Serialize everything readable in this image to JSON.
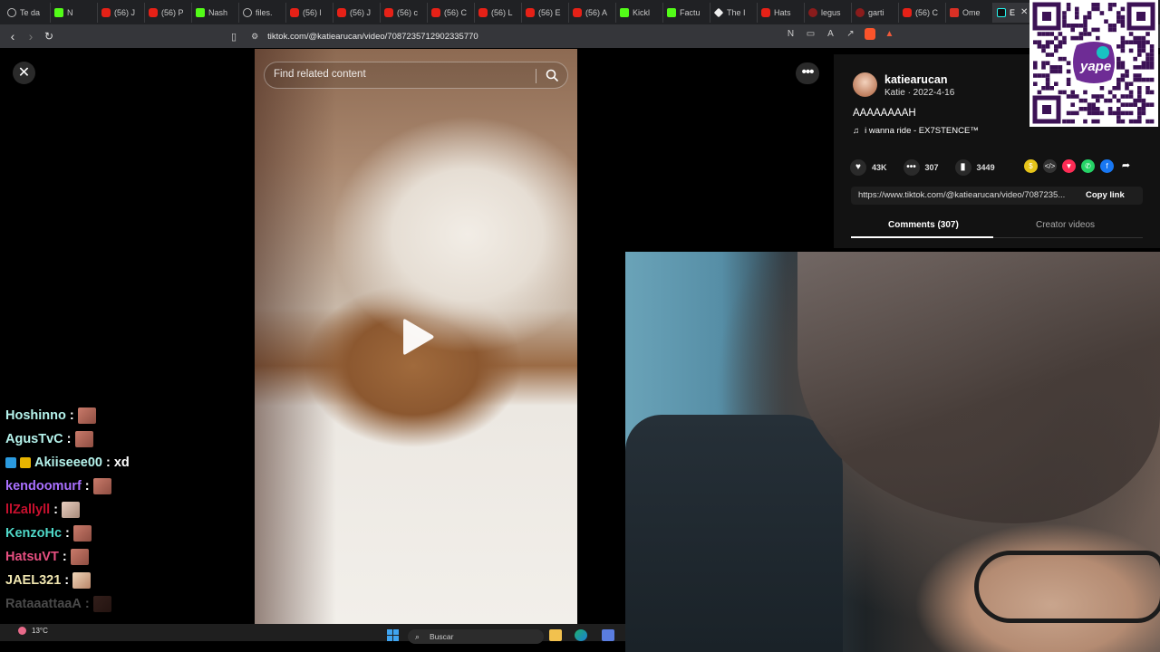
{
  "browser": {
    "tabs": [
      {
        "label": "Te da",
        "icon": "globe-icon"
      },
      {
        "label": "N",
        "icon": "kick-icon"
      },
      {
        "label": "(56) J",
        "icon": "youtube-icon"
      },
      {
        "label": "(56) P",
        "icon": "youtube-icon"
      },
      {
        "label": "Nash",
        "icon": "kick-icon"
      },
      {
        "label": "files.",
        "icon": "globe-icon"
      },
      {
        "label": "(56) l",
        "icon": "youtube-icon"
      },
      {
        "label": "(56) J",
        "icon": "youtube-icon"
      },
      {
        "label": "(56) c",
        "icon": "youtube-icon"
      },
      {
        "label": "(56) C",
        "icon": "youtube-icon"
      },
      {
        "label": "(56) L",
        "icon": "youtube-icon"
      },
      {
        "label": "(56) E",
        "icon": "youtube-icon"
      },
      {
        "label": "(56) A",
        "icon": "youtube-icon"
      },
      {
        "label": "Kickl",
        "icon": "kick-icon"
      },
      {
        "label": "Factu",
        "icon": "kick-icon"
      },
      {
        "label": "The I",
        "icon": "diamond-icon"
      },
      {
        "label": "Hats",
        "icon": "youtube-icon"
      },
      {
        "label": "legus",
        "icon": "dark-icon"
      },
      {
        "label": "garti",
        "icon": "dark-icon"
      },
      {
        "label": "(56) C",
        "icon": "youtube-icon"
      },
      {
        "label": "Ome",
        "icon": "mail-icon"
      },
      {
        "label": "E",
        "icon": "tiktok-icon",
        "active": true
      }
    ],
    "tab_close": "✕",
    "url": "tiktok.com/@katiearucan/video/7087235712902335770"
  },
  "video": {
    "search_placeholder": "Find related content"
  },
  "close_label": "✕",
  "more_label": "•••",
  "post": {
    "username": "katiearucan",
    "subline": "Katie · 2022-4-16",
    "caption": "AAAAAAAAH",
    "music": "i wanna ride - EX7STENCE™",
    "likes": "43K",
    "comments": "307",
    "saves": "3449",
    "link": "https://www.tiktok.com/@katiearucan/video/7087235...",
    "copy_label": "Copy link",
    "tab_comments": "Comments (307)",
    "tab_creator": "Creator videos"
  },
  "chat": [
    {
      "user": "Hoshinno",
      "color": "#b5f3ec",
      "msg": "",
      "emote": "emote"
    },
    {
      "user": "AgusTvC",
      "color": "#b5f3ec",
      "msg": "",
      "emote": "emote"
    },
    {
      "user": "Akiiseee00",
      "color": "#b5f3ec",
      "msg": "xd",
      "emote": ""
    },
    {
      "user": "kendoomurf",
      "color": "#a970ff",
      "msg": "",
      "emote": "emote"
    },
    {
      "user": "llZallyll",
      "color": "#c8102e",
      "msg": "",
      "emote": "emote"
    },
    {
      "user": "KenzoHc",
      "color": "#4fd8c8",
      "msg": "",
      "emote": "emote"
    },
    {
      "user": "HatsuVT",
      "color": "#e64f80",
      "msg": "",
      "emote": "emote"
    },
    {
      "user": "JAEL321",
      "color": "#f0e6b0",
      "msg": "",
      "emote": "emote"
    },
    {
      "user": "RataaattaaA",
      "color": "#4a4a4a",
      "msg": "",
      "emote": "emote"
    }
  ],
  "taskbar": {
    "weather": "13°C",
    "search": "Buscar"
  },
  "colors": {
    "tiktok_bg": "#121212",
    "accent_red": "#fe2c55"
  }
}
